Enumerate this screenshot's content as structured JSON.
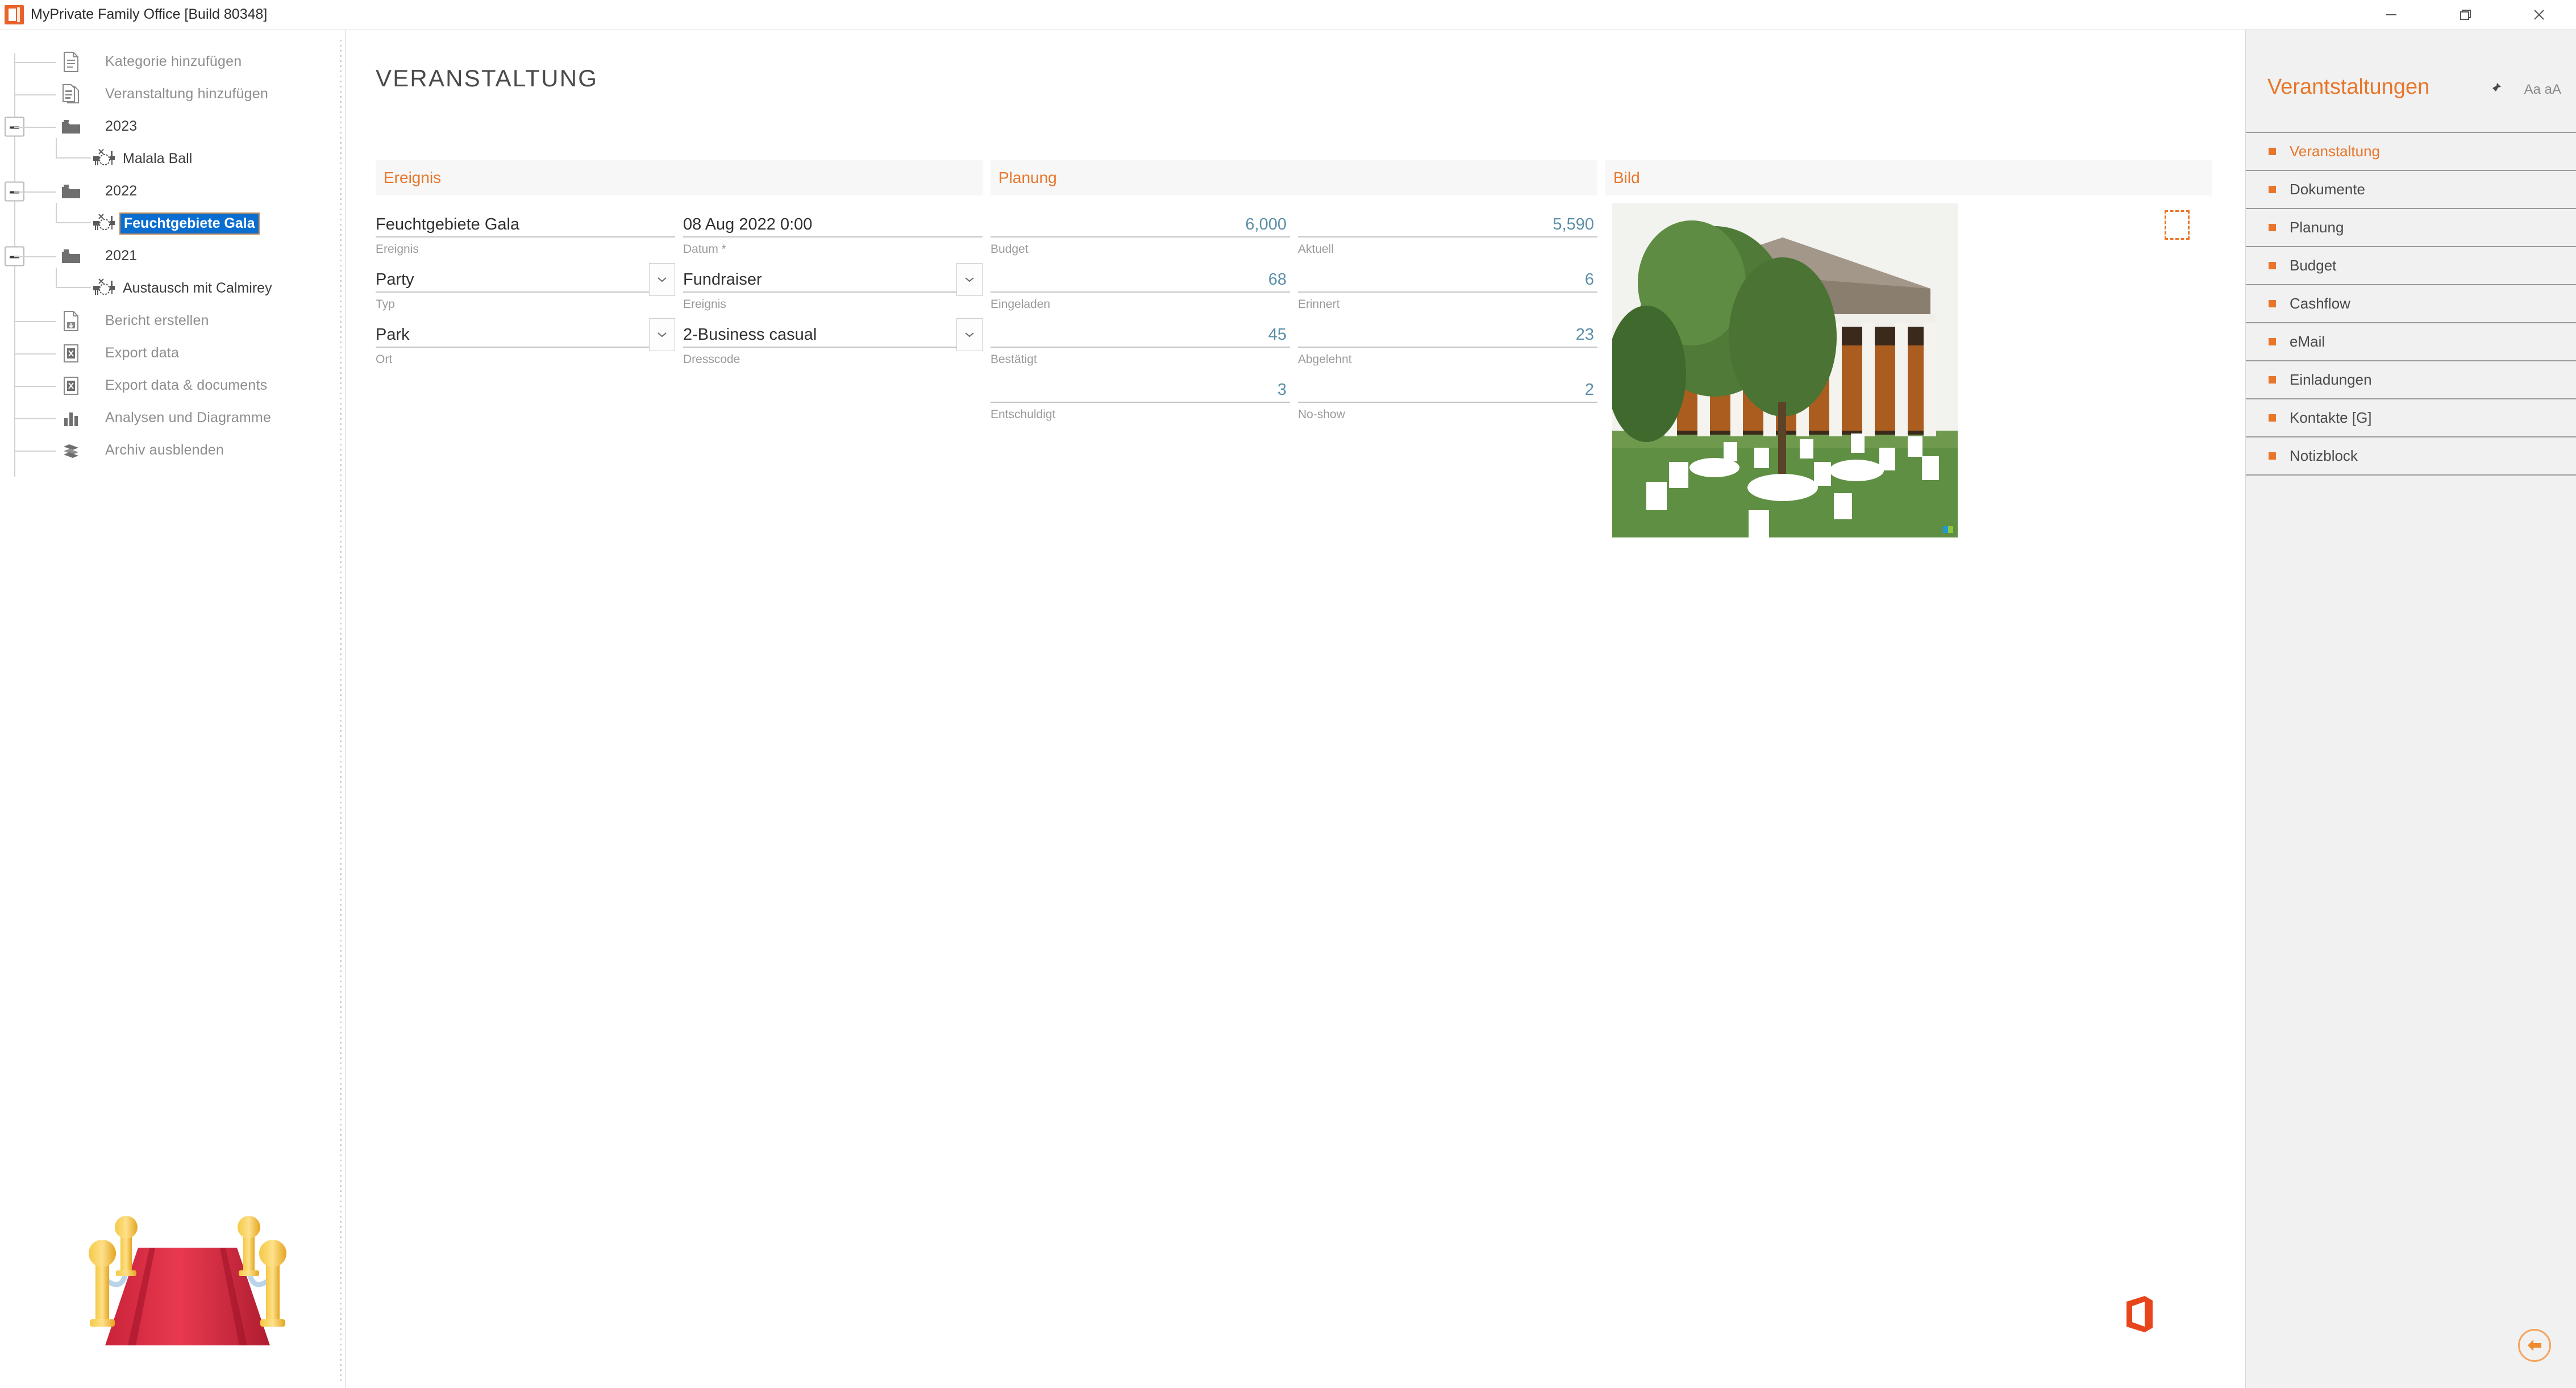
{
  "window": {
    "title": "MyPrivate Family Office [Build 80348]",
    "app_icon": "office-app-icon",
    "minimize_label": "Minimieren",
    "maximize_label": "Maximieren",
    "close_label": "Schließen"
  },
  "sidebar": {
    "items": [
      {
        "label": "Kategorie hinzufügen",
        "icon": "document-add-icon",
        "type": "action"
      },
      {
        "label": "Veranstaltung hinzufügen",
        "icon": "documents-add-icon",
        "type": "action"
      }
    ],
    "folders": [
      {
        "label": "2023",
        "icon": "folder-icon",
        "expanded": true,
        "children": [
          {
            "label": "Malala Ball",
            "icon": "event-table-icon",
            "selected": false
          }
        ]
      },
      {
        "label": "2022",
        "icon": "folder-icon",
        "expanded": true,
        "children": [
          {
            "label": "Feuchtgebiete Gala",
            "icon": "event-table-icon",
            "selected": true
          }
        ]
      },
      {
        "label": "2021",
        "icon": "folder-icon",
        "expanded": true,
        "children": [
          {
            "label": "Austausch mit Calmirey",
            "icon": "event-table-icon",
            "selected": false
          }
        ]
      }
    ],
    "footer_items": [
      {
        "label": "Bericht erstellen",
        "icon": "report-icon"
      },
      {
        "label": "Export data",
        "icon": "excel-icon"
      },
      {
        "label": "Export data & documents",
        "icon": "excel-icon"
      },
      {
        "label": "Analysen und Diagramme",
        "icon": "bar-chart-icon"
      },
      {
        "label": "Archiv ausblenden",
        "icon": "archive-icon"
      }
    ],
    "decoration_icon": "red-carpet-illustration"
  },
  "main": {
    "page_title": "VERANSTALTUNG",
    "office_logo_icon": "office-logo-icon",
    "ereignis": {
      "header": "Ereignis",
      "fields": [
        {
          "caption": "Ereignis",
          "value": "Feuchtgebiete Gala",
          "kind": "text"
        },
        {
          "caption": "Datum *",
          "value": "08 Aug 2022 0:00",
          "kind": "text"
        },
        {
          "caption": "Typ",
          "value": "Party",
          "kind": "select"
        },
        {
          "caption": "Ereignis",
          "value": "Fundraiser",
          "kind": "select"
        },
        {
          "caption": "Ort",
          "value": "Park",
          "kind": "select"
        },
        {
          "caption": "Dresscode",
          "value": "2-Business casual",
          "kind": "select"
        }
      ]
    },
    "planung": {
      "header": "Planung",
      "fields": [
        {
          "caption": "Budget",
          "value": "6,000",
          "kind": "number"
        },
        {
          "caption": "Aktuell",
          "value": "5,590",
          "kind": "number"
        },
        {
          "caption": "Eingeladen",
          "value": "68",
          "kind": "number"
        },
        {
          "caption": "Erinnert",
          "value": "6",
          "kind": "number"
        },
        {
          "caption": "Bestätigt",
          "value": "45",
          "kind": "number"
        },
        {
          "caption": "Abgelehnt",
          "value": "23",
          "kind": "number"
        },
        {
          "caption": "Entschuldigt",
          "value": "3",
          "kind": "number"
        },
        {
          "caption": "No-show",
          "value": "2",
          "kind": "number"
        }
      ]
    },
    "bild": {
      "header": "Bild",
      "photo_icon": "venue-photo",
      "placeholder_icon": "image-placeholder-icon"
    }
  },
  "right_panel": {
    "title": "Verantstaltungen",
    "pin_icon": "pin-icon",
    "font_size_label": "Aa aA",
    "items": [
      {
        "label": "Veranstaltung",
        "active": true
      },
      {
        "label": "Dokumente",
        "active": false
      },
      {
        "label": "Planung",
        "active": false
      },
      {
        "label": "Budget",
        "active": false
      },
      {
        "label": "Cashflow",
        "active": false
      },
      {
        "label": "eMail",
        "active": false
      },
      {
        "label": "Einladungen",
        "active": false
      },
      {
        "label": "Kontakte [G]",
        "active": false
      },
      {
        "label": "Notizblock",
        "active": false
      }
    ],
    "back_icon": "back-arrow-icon"
  },
  "colors": {
    "accent": "#e8762a",
    "number": "#5b8fa8",
    "selection": "#0a6ed1",
    "panel_bg": "#f1f1f1"
  }
}
